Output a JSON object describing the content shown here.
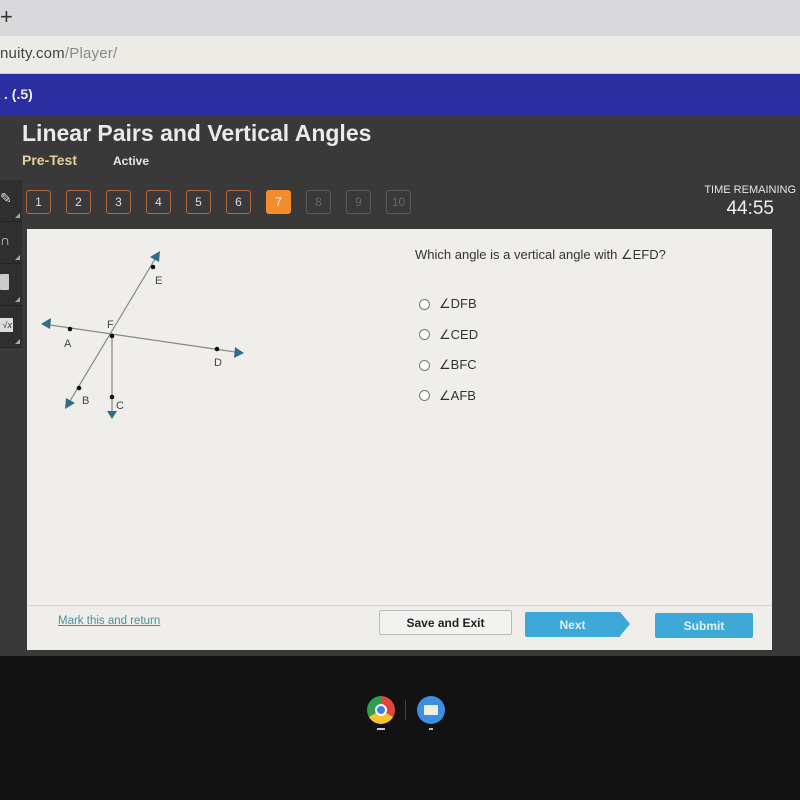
{
  "browser": {
    "new_tab_icon": "plus-icon",
    "new_tab_glyph": "+",
    "url_domain": "nuity.com",
    "url_path": "/Player/"
  },
  "header": {
    "title_fragment": ". (.5)"
  },
  "lesson": {
    "title": "Linear Pairs and Vertical Angles",
    "mode": "Pre-Test",
    "status": "Active"
  },
  "question_nav": {
    "current": 7,
    "items": [
      {
        "label": "1",
        "state": "answered"
      },
      {
        "label": "2",
        "state": "answered"
      },
      {
        "label": "3",
        "state": "answered"
      },
      {
        "label": "4",
        "state": "answered"
      },
      {
        "label": "5",
        "state": "answered"
      },
      {
        "label": "6",
        "state": "answered"
      },
      {
        "label": "7",
        "state": "current"
      },
      {
        "label": "8",
        "state": "locked"
      },
      {
        "label": "9",
        "state": "locked"
      },
      {
        "label": "10",
        "state": "locked"
      }
    ]
  },
  "timer": {
    "label": "TIME REMAINING",
    "value": "44:55"
  },
  "tools": [
    {
      "icon": "pencil-icon"
    },
    {
      "icon": "headphones-icon"
    },
    {
      "icon": "calculator-icon"
    },
    {
      "icon": "formula-icon",
      "glyph": "√x"
    }
  ],
  "diagram": {
    "point_labels": [
      "E",
      "F",
      "A",
      "D",
      "B",
      "C"
    ],
    "accent_color": "#2f6f86"
  },
  "question": {
    "prompt": "Which angle is a vertical angle with ∠EFD?",
    "choices": [
      "∠DFB",
      "∠CED",
      "∠BFC",
      "∠AFB"
    ]
  },
  "footer": {
    "mark_link": "Mark this and return",
    "save_exit": "Save and Exit",
    "next": "Next",
    "submit": "Submit"
  },
  "taskbar": {
    "apps": [
      "chrome-icon",
      "files-icon"
    ]
  }
}
